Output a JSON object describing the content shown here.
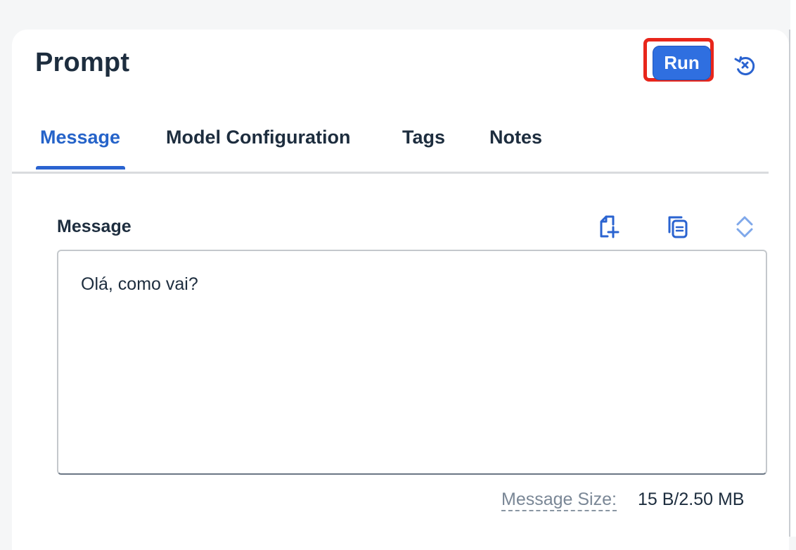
{
  "header": {
    "title": "Prompt",
    "run_label": "Run",
    "reset_icon": "reset-icon"
  },
  "tabs": [
    {
      "label": "Message",
      "active": true
    },
    {
      "label": "Model Configuration",
      "active": false
    },
    {
      "label": "Tags",
      "active": false
    },
    {
      "label": "Notes",
      "active": false
    }
  ],
  "message_section": {
    "label": "Message",
    "toolbar_icons": [
      "add-document-icon",
      "copy-icon",
      "expand-collapse-icon"
    ],
    "text": "Olá, como vai?",
    "size_label": "Message Size:",
    "size_value": "15 B/2.50 MB"
  },
  "colors": {
    "accent": "#2a63d0",
    "run_button": "#2f6fe0",
    "highlight": "#e8261b"
  }
}
